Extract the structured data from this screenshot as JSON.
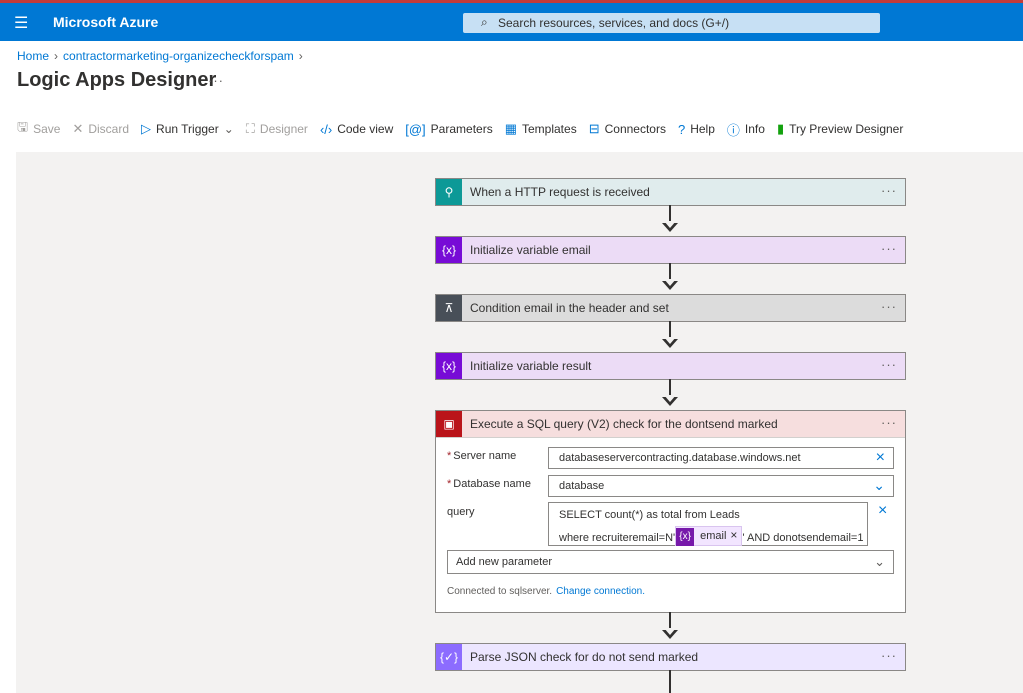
{
  "topbar": {
    "brand": "Microsoft Azure",
    "search_placeholder": "Search resources, services, and docs (G+/)"
  },
  "breadcrumb": {
    "home": "Home",
    "resource": "contractormarketing-organizecheckforspam"
  },
  "page": {
    "title": "Logic Apps Designer",
    "more": "···"
  },
  "toolbar": {
    "save": "Save",
    "discard": "Discard",
    "run_trigger": "Run Trigger",
    "designer": "Designer",
    "code_view": "Code view",
    "parameters": "Parameters",
    "templates": "Templates",
    "connectors": "Connectors",
    "help": "Help",
    "info": "Info",
    "try_preview": "Try Preview Designer"
  },
  "steps": [
    {
      "label": "When a HTTP request is received",
      "icon": "http-request-icon",
      "color": "#0c9997",
      "bg": "#e0eced"
    },
    {
      "label": "Initialize variable email",
      "icon": "variable-icon",
      "color": "#770bd6",
      "bg": "#ecdcf6"
    },
    {
      "label": "Condition email in the header and set",
      "icon": "condition-icon",
      "color": "#484f58",
      "bg": "#dcdcdc"
    },
    {
      "label": "Initialize variable result",
      "icon": "variable-icon",
      "color": "#770bd6",
      "bg": "#ecdcf6"
    },
    {
      "label": "Execute a SQL query (V2) check for the dontsend marked",
      "icon": "sql-icon",
      "color": "#ba141a",
      "bg": "#f6dede"
    },
    {
      "label": "Parse JSON check for do not send marked",
      "icon": "parse-json-icon",
      "color": "#8c6cff",
      "bg": "#ece6ff"
    }
  ],
  "step_more": "···",
  "sql": {
    "server_label": "Server name",
    "server_value": "databaseservercontracting.database.windows.net",
    "db_label": "Database name",
    "db_value": "database",
    "query_label": "query",
    "query_line1": "SELECT count(*) as total from Leads",
    "query_line2_prefix": "where recruiteremail=N'",
    "token_label": "email",
    "query_line2_suffix": "' AND donotsendemail=1",
    "add_param": "Add new parameter",
    "connected": "Connected to sqlserver.",
    "change_connection": "Change connection."
  }
}
